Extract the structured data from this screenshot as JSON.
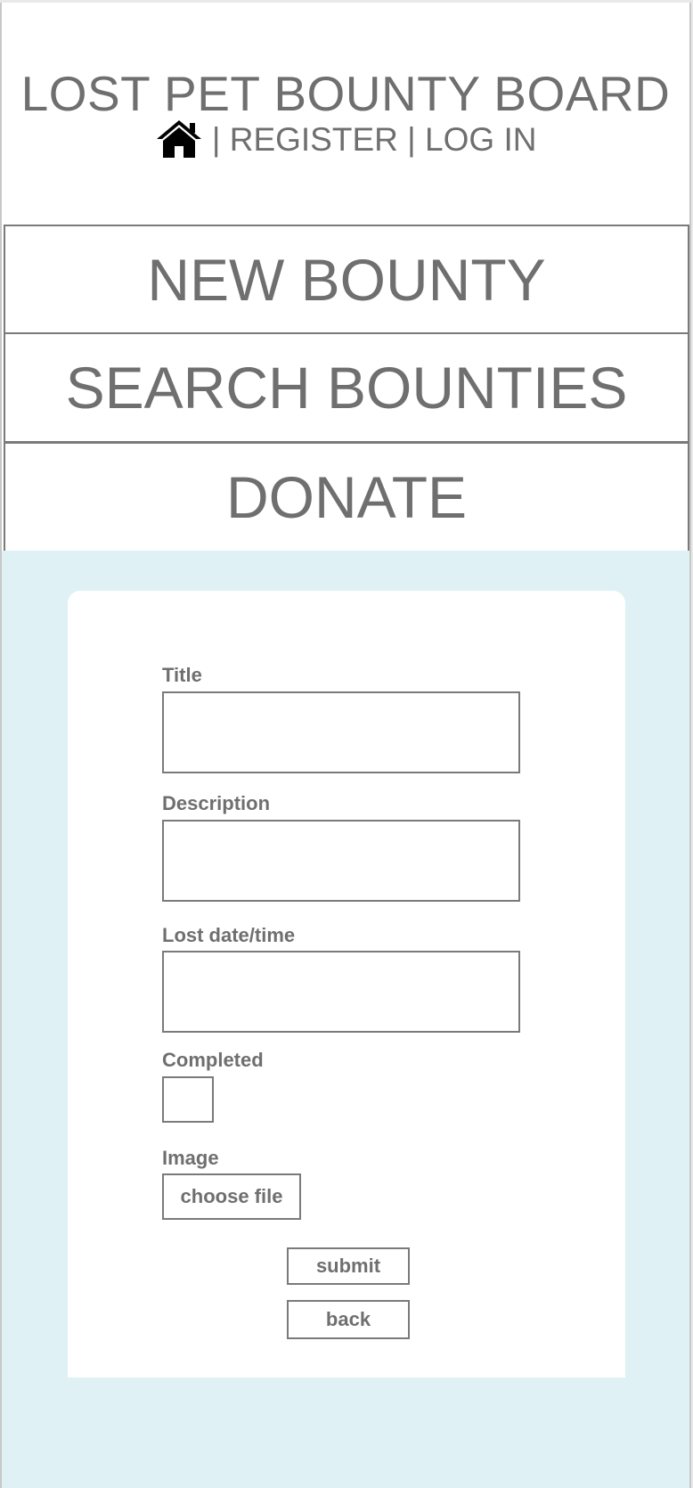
{
  "header": {
    "title": "LOST PET BOUNTY BOARD",
    "separator": "|",
    "register": "REGISTER",
    "login": "LOG IN",
    "home_icon": "home-icon"
  },
  "nav": {
    "new_bounty": "NEW BOUNTY",
    "search_bounties": "SEARCH BOUNTIES",
    "donate": "DONATE"
  },
  "form": {
    "title_label": "Title",
    "title_value": "",
    "description_label": "Description",
    "description_value": "",
    "lost_label": "Lost date/time",
    "lost_value": "",
    "completed_label": "Completed",
    "image_label": "Image",
    "choose_file": "choose file",
    "submit": "submit",
    "back": "back"
  },
  "colors": {
    "text": "#6f6f6f",
    "content_background": "#dff1f5",
    "border": "#7a7a7a"
  }
}
